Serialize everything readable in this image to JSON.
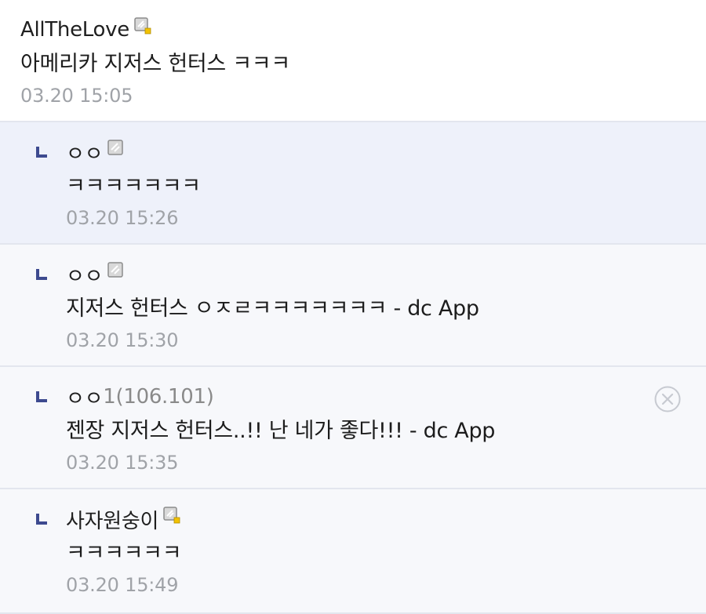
{
  "comments": [
    {
      "author": "AllTheLove",
      "ip": "",
      "text": "아메리카 지저스 헌터스 ㅋㅋㅋ",
      "time": "03.20 15:05",
      "badge_icon": "fixed-nick-icon"
    },
    {
      "author": "ㅇㅇ",
      "ip": "",
      "text": "ㅋㅋㅋㅋㅋㅋㅋ",
      "time": "03.20 15:26",
      "badge_icon": "gallog-icon"
    },
    {
      "author": "ㅇㅇ",
      "ip": "",
      "text": "지저스 헌터스 ㅇㅈㄹㅋㅋㅋㅋㅋㅋㅋ - dc App",
      "time": "03.20 15:30",
      "badge_icon": "gallog-icon"
    },
    {
      "author": "ㅇㅇ",
      "ip": "1(106.101)",
      "text": "젠장 지저스 헌터스..!! 난 네가 좋다!!! - dc App",
      "time": "03.20 15:35",
      "delete_icon": "close-circle-icon"
    },
    {
      "author": "사자원숭이",
      "ip": "",
      "text": "ㅋㅋㅋㅋㅋㅋ",
      "time": "03.20 15:49",
      "badge_icon": "fixed-nick-icon"
    }
  ],
  "colors": {
    "reply_mark": "#3d4a8f",
    "highlight_bg": "#eef1fa",
    "reply_bg": "#f7f8fb",
    "time_text": "#a0a3a8",
    "badge_dot": "#f2c200"
  }
}
